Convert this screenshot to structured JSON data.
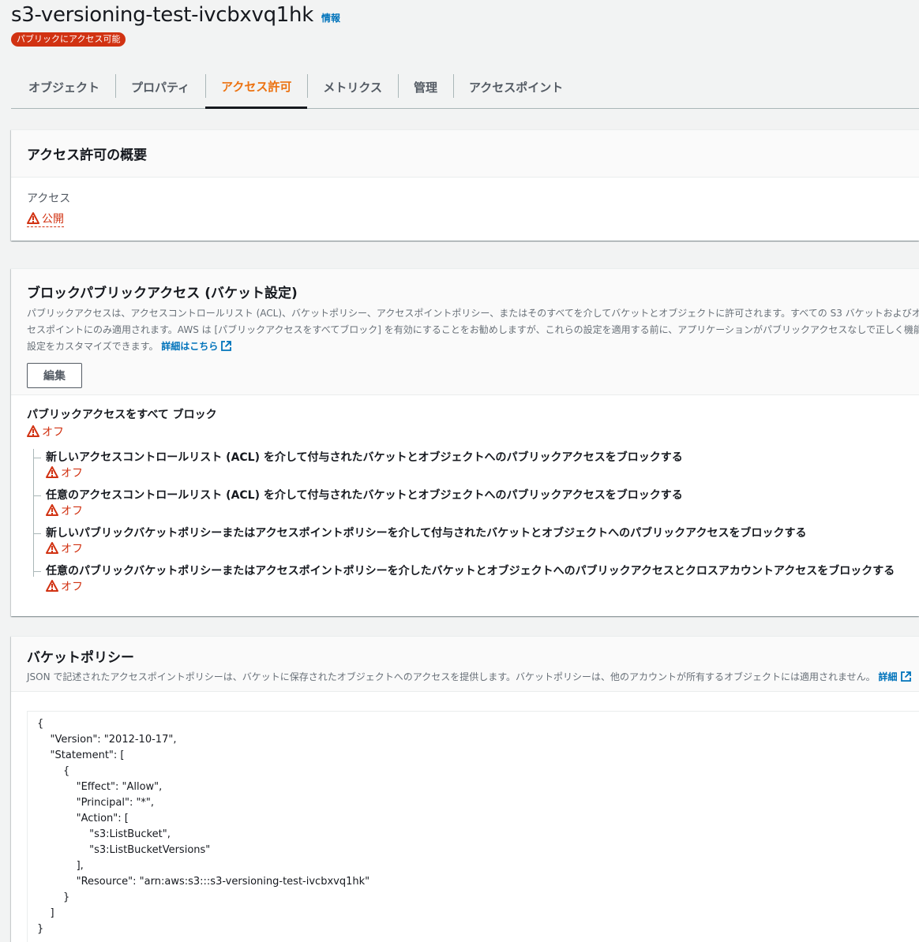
{
  "header": {
    "bucket_name": "s3-versioning-test-ivcbxvq1hk",
    "info_link": "情報",
    "public_badge": "パブリックにアクセス可能"
  },
  "tabs": [
    {
      "label": "オブジェクト",
      "active": false
    },
    {
      "label": "プロパティ",
      "active": false
    },
    {
      "label": "アクセス許可",
      "active": true
    },
    {
      "label": "メトリクス",
      "active": false
    },
    {
      "label": "管理",
      "active": false
    },
    {
      "label": "アクセスポイント",
      "active": false
    }
  ],
  "overview": {
    "title": "アクセス許可の概要",
    "access_label": "アクセス",
    "access_value": "公開"
  },
  "block_public": {
    "title": "ブロックパブリックアクセス (バケット設定)",
    "desc_line1": "パブリックアクセスは、アクセスコントロールリスト (ACL)、バケットポリシー、アクセスポイントポリシー、またはそのすべてを介してバケットとオブジェクトに許可されます。すべての S3 バケットおよびオ",
    "desc_line2": "セスポイントにのみ適用されます。AWS は [パブリックアクセスをすべてブロック] を有効にすることをお勧めしますが、これらの設定を適用する前に、アプリケーションがパブリックアクセスなしで正しく機能",
    "desc_line3": "設定をカスタマイズできます。",
    "learn_more": "詳細はこちら",
    "edit_button": "編集",
    "block_all_label": "パブリックアクセスをすべて ブロック",
    "block_all_status": "オフ",
    "settings": [
      {
        "label": "新しいアクセスコントロールリスト (ACL) を介して付与されたバケットとオブジェクトへのパブリックアクセスをブロックする",
        "status": "オフ"
      },
      {
        "label": "任意のアクセスコントロールリスト (ACL) を介して付与されたバケットとオブジェクトへのパブリックアクセスをブロックする",
        "status": "オフ"
      },
      {
        "label": "新しいパブリックバケットポリシーまたはアクセスポイントポリシーを介して付与されたバケットとオブジェクトへのパブリックアクセスをブロックする",
        "status": "オフ"
      },
      {
        "label": "任意のパブリックバケットポリシーまたはアクセスポイントポリシーを介したバケットとオブジェクトへのパブリックアクセスとクロスアカウントアクセスをブロックする",
        "status": "オフ"
      }
    ]
  },
  "bucket_policy": {
    "title": "バケットポリシー",
    "description": "JSON で記述されたアクセスポイントポリシーは、バケットに保存されたオブジェクトへのアクセスを提供します。バケットポリシーは、他のアカウントが所有するオブジェクトには適用されません。",
    "learn_more": "詳細",
    "policy_lines": [
      "{",
      "    \"Version\": \"2012-10-17\",",
      "    \"Statement\": [",
      "        {",
      "            \"Effect\": \"Allow\",",
      "            \"Principal\": \"*\",",
      "            \"Action\": [",
      "                \"s3:ListBucket\",",
      "                \"s3:ListBucketVersions\"",
      "            ],",
      "            \"Resource\": \"arn:aws:s3:::s3-versioning-test-ivcbxvq1hk\"",
      "        }",
      "    ]",
      "}"
    ]
  },
  "icons": {
    "warning": "warning-triangle-icon",
    "external": "external-link-icon"
  },
  "colors": {
    "accent": "#ec7211",
    "danger": "#d13212",
    "link": "#0073bb"
  }
}
